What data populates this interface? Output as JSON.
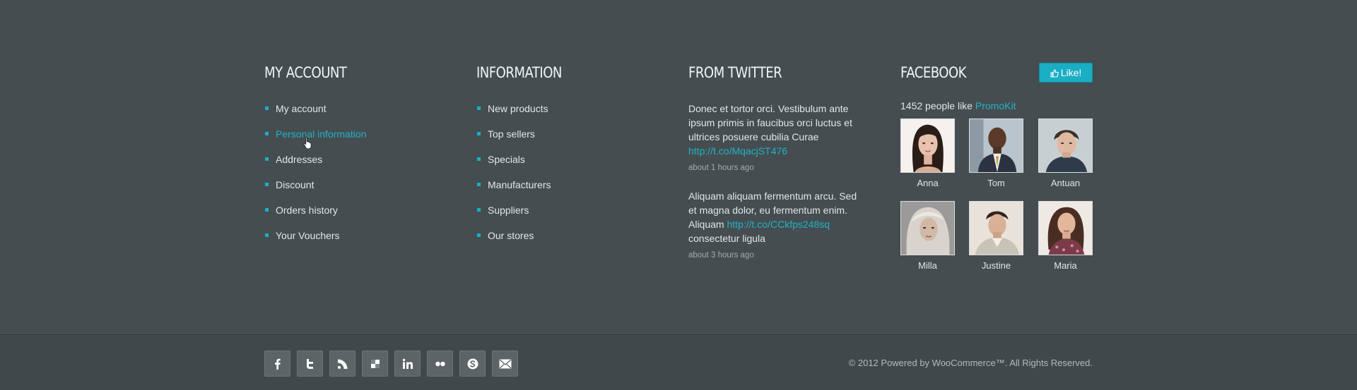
{
  "account": {
    "title": "My Account",
    "items": [
      {
        "label": "My account"
      },
      {
        "label": "Personal information"
      },
      {
        "label": "Addresses"
      },
      {
        "label": "Discount"
      },
      {
        "label": "Orders history"
      },
      {
        "label": "Your Vouchers"
      }
    ]
  },
  "information": {
    "title": "Information",
    "items": [
      {
        "label": "New products"
      },
      {
        "label": "Top sellers"
      },
      {
        "label": "Specials"
      },
      {
        "label": "Manufacturers"
      },
      {
        "label": "Suppliers"
      },
      {
        "label": "Our stores"
      }
    ]
  },
  "twitter": {
    "title": "From Twitter",
    "tweets": [
      {
        "text": "Donec et tortor orci. Vestibulum ante ipsum primis in faucibus orci luctus et ultrices posuere cubilia Curae",
        "link": "http://t.co/MqacjST476",
        "after": "",
        "time": "about 1 hours ago"
      },
      {
        "text": "Aliquam aliquam fermentum arcu. Sed et magna dolor, eu fermentum enim. Aliquam",
        "link": "http://t.co/CCkfps248sq",
        "after": "consectetur ligula",
        "time": "about 3 hours ago"
      }
    ]
  },
  "facebook": {
    "title": "Facebook",
    "like_label": "Like!",
    "count_text": "1452 people like",
    "page_name": "PromoKit",
    "fans": [
      {
        "name": "Anna"
      },
      {
        "name": "Tom"
      },
      {
        "name": "Antuan"
      },
      {
        "name": "Milla"
      },
      {
        "name": "Justine"
      },
      {
        "name": "Maria"
      }
    ]
  },
  "social": {
    "icons": [
      "facebook-icon",
      "twitter-icon",
      "rss-icon",
      "delicious-icon",
      "linkedin-icon",
      "flickr-icon",
      "skype-icon",
      "email-icon"
    ]
  },
  "copyright": "© 2012 Powered by WooCommerce™. All Rights Reserved.",
  "colors": {
    "background": "#454d50",
    "accent": "#19aec4",
    "link": "#1fb3c7"
  }
}
